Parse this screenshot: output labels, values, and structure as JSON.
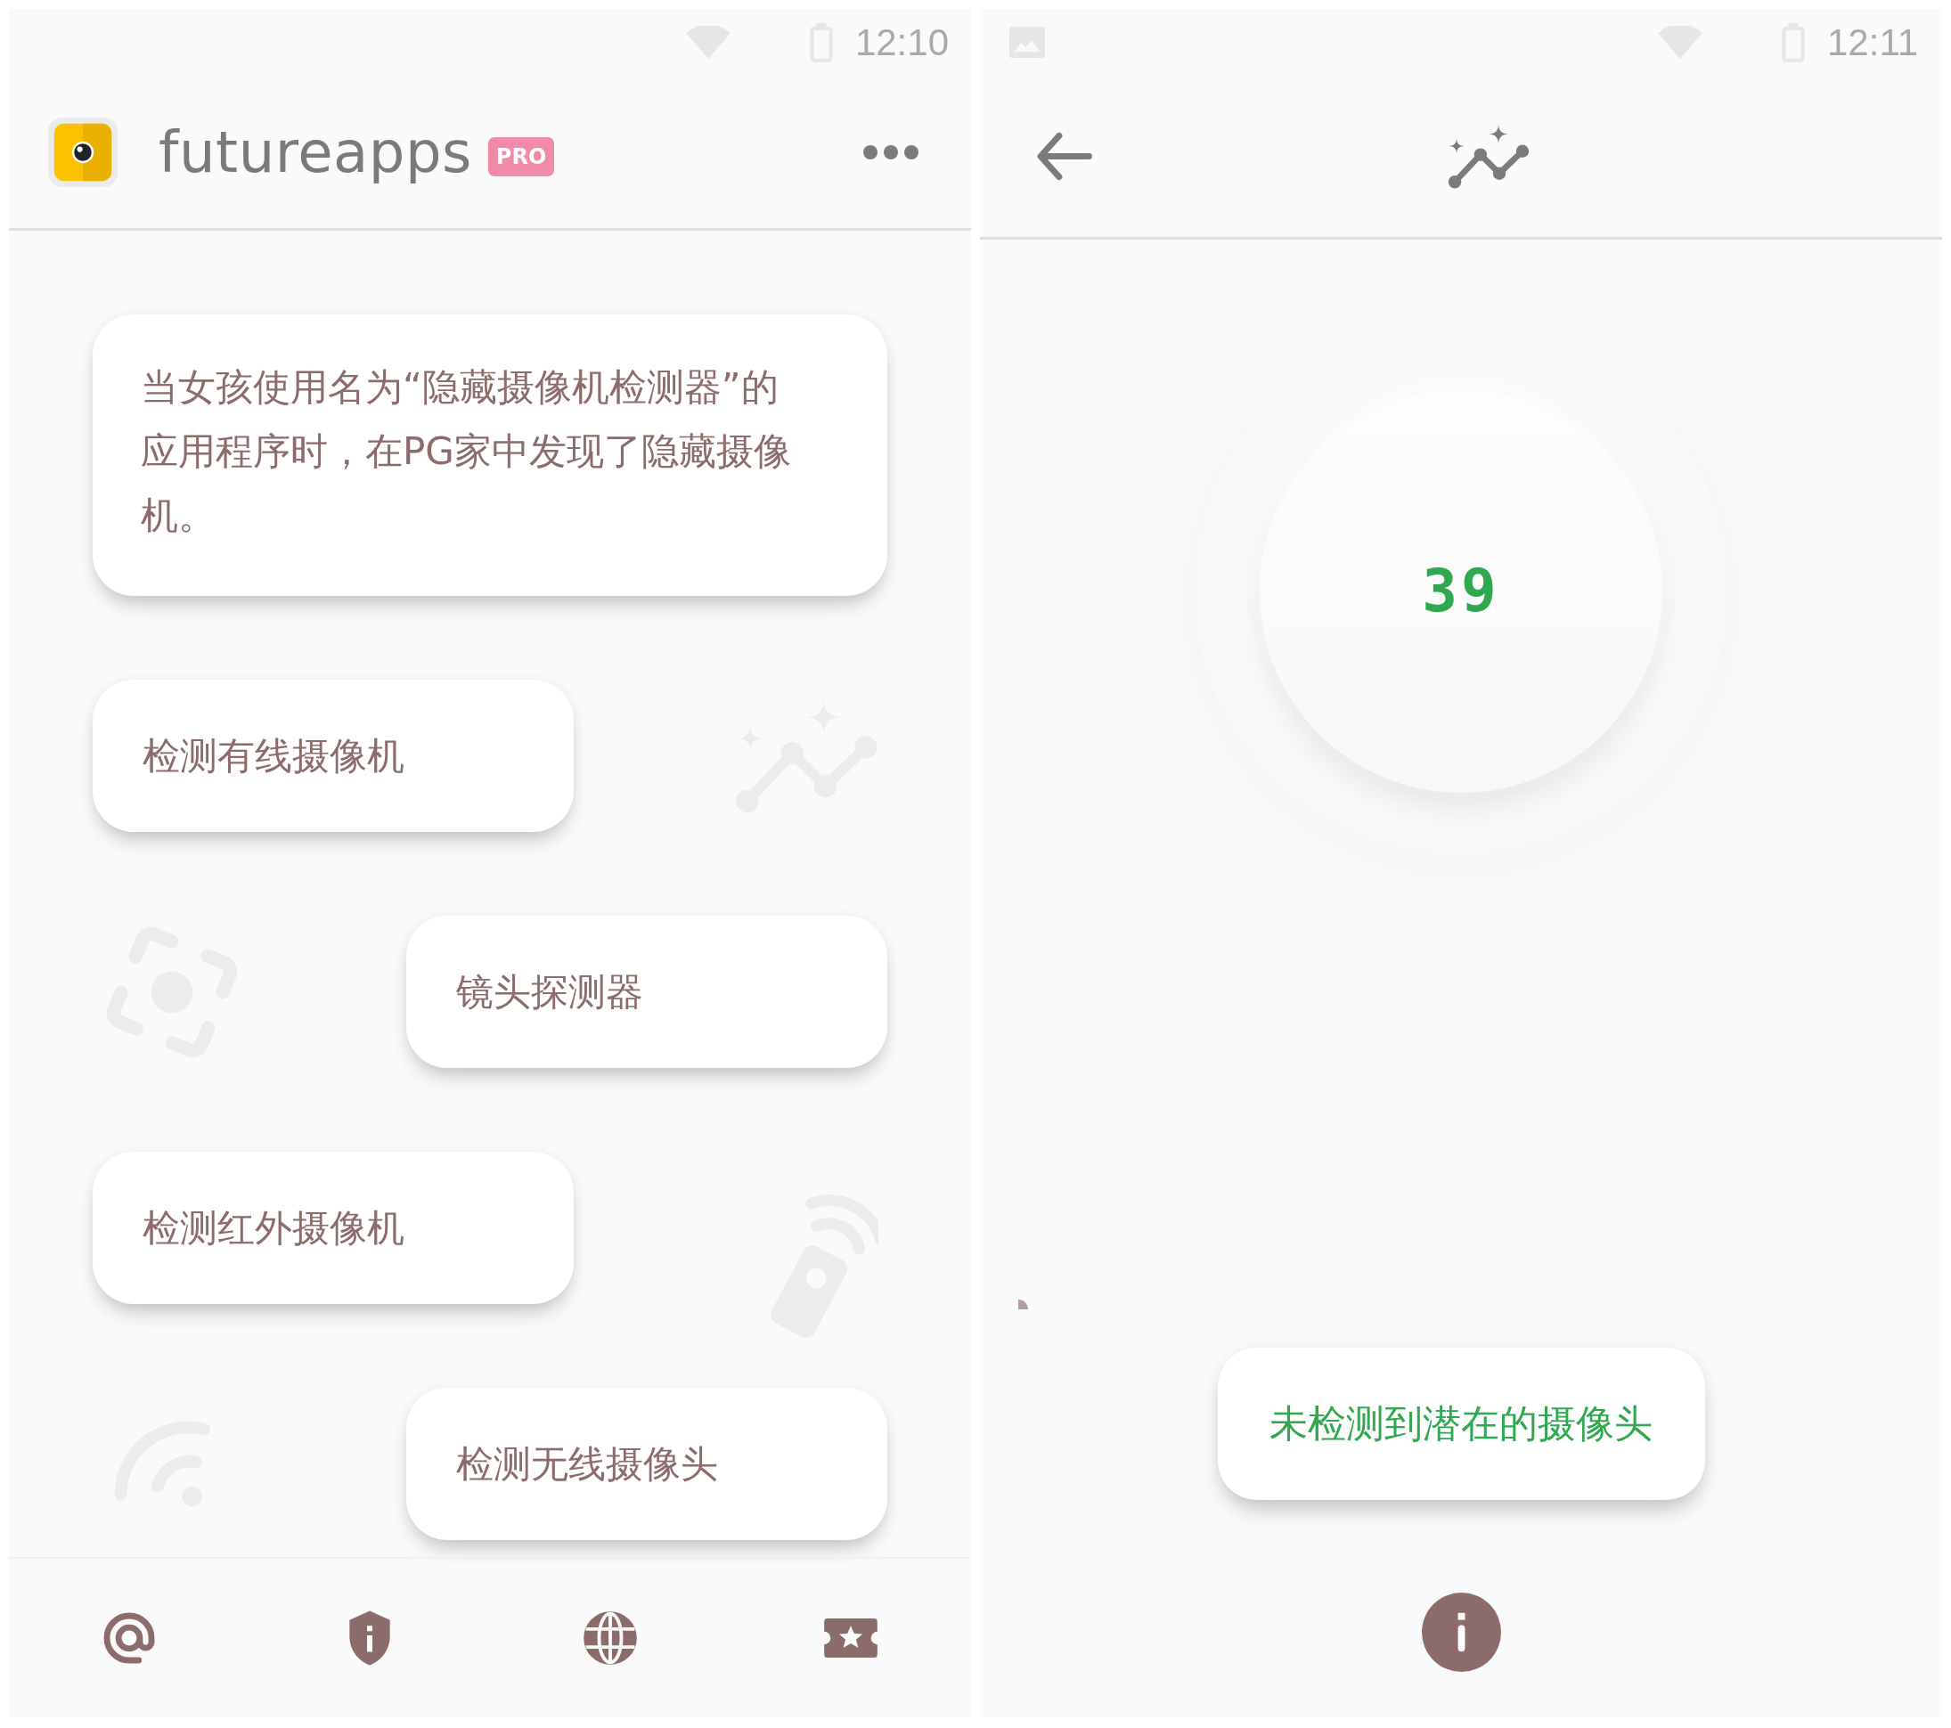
{
  "left_screen": {
    "status_bar": {
      "time": "12:10"
    },
    "app_bar": {
      "title": "futureapps",
      "badge": "PRO"
    },
    "intro_card": {
      "text": "当女孩使用名为“隐藏摄像机检测器”的应用程序时，在PG家中发现了隐藏摄像机。"
    },
    "menu_buttons": [
      {
        "label": "检测有线摄像机"
      },
      {
        "label": "镜头探测器"
      },
      {
        "label": "检测红外摄像机"
      },
      {
        "label": "检测无线摄像头"
      }
    ]
  },
  "right_screen": {
    "status_bar": {
      "time": "12:11"
    },
    "detector": {
      "reading": "39"
    },
    "result": {
      "text": "未检测到潜在的摄像头"
    }
  }
}
